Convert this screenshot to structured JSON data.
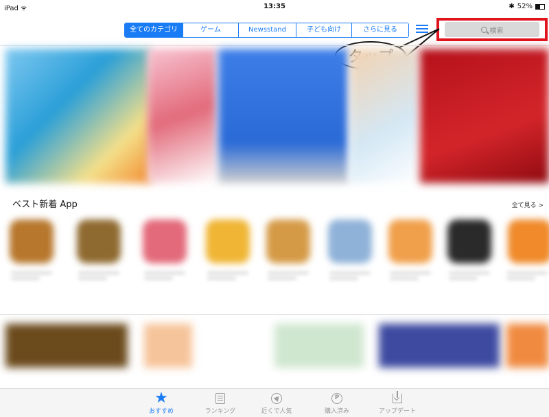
{
  "status_bar": {
    "device": "iPad",
    "time": "13:35",
    "battery": "52%"
  },
  "nav": {
    "segments": [
      "全てのカテゴリ",
      "ゲーム",
      "Newsstand",
      "子ども向け",
      "さらに見る"
    ],
    "active_index": 0
  },
  "search": {
    "placeholder": "検索"
  },
  "annotation": {
    "callout_text": "タップ",
    "highlight_color": "#e0141e"
  },
  "section": {
    "title": "ベスト新着 App",
    "see_all": "全て見る >"
  },
  "tabbar": {
    "tabs": [
      {
        "label": "おすすめ",
        "icon": "star-icon",
        "active": true
      },
      {
        "label": "ランキング",
        "icon": "list-icon",
        "active": false
      },
      {
        "label": "近くで人気",
        "icon": "location-icon",
        "active": false
      },
      {
        "label": "購入済み",
        "icon": "purchased-icon",
        "active": false
      },
      {
        "label": "アップデート",
        "icon": "update-icon",
        "active": false
      }
    ]
  },
  "colors": {
    "accent": "#1a7cf5",
    "annotation": "#e0141e"
  }
}
